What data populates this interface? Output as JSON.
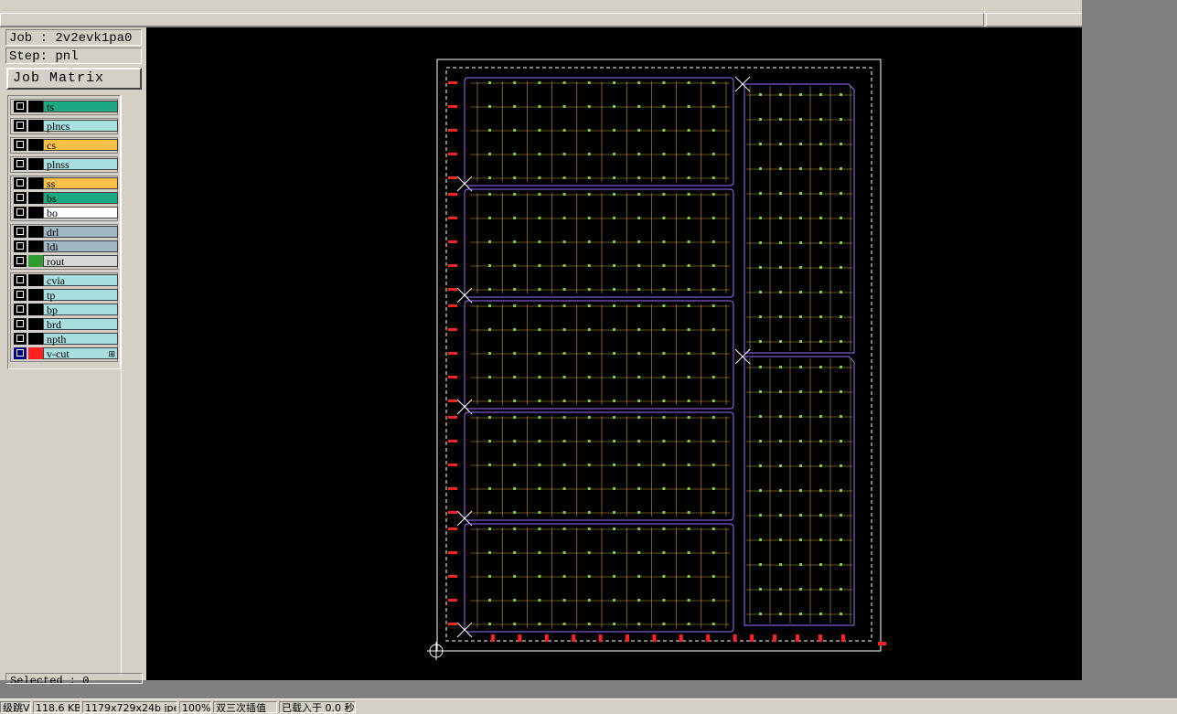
{
  "job": {
    "label": "Job : 2v2evk1pa0",
    "step": "Step: pnl"
  },
  "matrix_button": "Job Matrix ...",
  "selected_text": "Selected : 0",
  "layer_groups": [
    {
      "rows": [
        {
          "name": "ts",
          "color": "#1aa980"
        }
      ]
    },
    {
      "rows": [
        {
          "name": "plncs",
          "color": "#a8e0e0"
        }
      ]
    },
    {
      "rows": [
        {
          "name": "cs",
          "color": "#ffc04a"
        }
      ]
    },
    {
      "rows": [
        {
          "name": "plnss",
          "color": "#a8e0e0"
        }
      ]
    },
    {
      "rows": [
        {
          "name": "ss",
          "color": "#ffc04a"
        },
        {
          "name": "bs",
          "color": "#1aa980"
        },
        {
          "name": "bo",
          "color": "#ffffff"
        }
      ]
    },
    {
      "rows": [
        {
          "name": "drl",
          "color": "#9fb8c4"
        },
        {
          "name": "ldi",
          "color": "#9fb8c4"
        },
        {
          "name": "rout",
          "color": "#d8d8d8",
          "swatch": "#2f9a2f"
        }
      ]
    },
    {
      "rows": [
        {
          "name": "cvia",
          "color": "#a8e0e0"
        },
        {
          "name": "tp",
          "color": "#a8e0e0"
        },
        {
          "name": "bp",
          "color": "#a8e0e0"
        },
        {
          "name": "brd",
          "color": "#a8e0e0"
        },
        {
          "name": "npth",
          "color": "#a8e0e0"
        },
        {
          "name": "v-cut",
          "color": "#a8e0e0",
          "swatch": "#ff2020",
          "chk_color": "#000080"
        }
      ]
    }
  ],
  "status": {
    "cell1": "级跳V",
    "cell2": "118.6 KB",
    "cell3": "1179x729x24b jpeg",
    "cell4": "100%",
    "cell5": "双三次插值",
    "cell6": "已载入于 0.0 秒"
  },
  "colors": {
    "panel_outline": "#ffffff",
    "dashed_border": "#ffffff",
    "pcb_outline": "#9b6cff",
    "grid_lines": "#c8a040",
    "pads": "#7fd040",
    "fiducial_text": "#ff2020"
  }
}
